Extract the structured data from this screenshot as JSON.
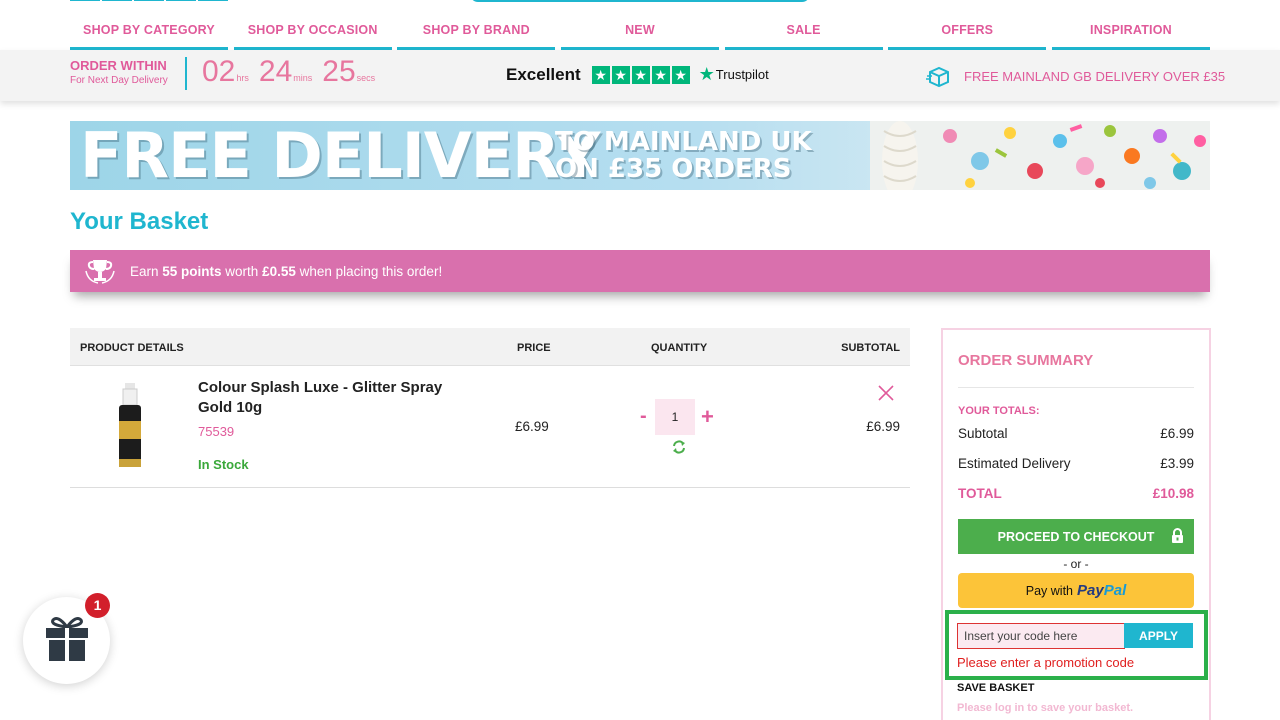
{
  "nav": {
    "items": [
      "SHOP BY CATEGORY",
      "SHOP BY OCCASION",
      "SHOP BY BRAND",
      "NEW",
      "SALE",
      "OFFERS",
      "INSPIRATION"
    ]
  },
  "info_bar": {
    "order_within": "ORDER WITHIN",
    "order_sub": "For Next Day Delivery",
    "hours": "02",
    "hours_unit": "hrs",
    "mins": "24",
    "mins_unit": "mins",
    "secs": "25",
    "secs_unit": "secs",
    "rating_text": "Excellent",
    "trustpilot": "Trustpilot",
    "delivery_text": "FREE MAINLAND GB DELIVERY OVER £35"
  },
  "banner": {
    "headline": "FREE DELIVERY",
    "line1": "TO MAINLAND UK",
    "line2": "ON £35 ORDERS"
  },
  "page": {
    "title": "Your Basket"
  },
  "points": {
    "prefix": "Earn ",
    "points": "55 points",
    "middle": " worth ",
    "value": "£0.55",
    "suffix": " when placing this order!"
  },
  "table": {
    "headers": [
      "PRODUCT DETAILS",
      "PRICE",
      "QUANTITY",
      "SUBTOTAL"
    ],
    "items": [
      {
        "name": "Colour Splash Luxe - Glitter Spray Gold 10g",
        "code": "75539",
        "stock": "In Stock",
        "price": "£6.99",
        "quantity": "1",
        "subtotal": "£6.99"
      }
    ],
    "minus": "-",
    "plus": "+"
  },
  "summary": {
    "title": "ORDER SUMMARY",
    "totals_label": "YOUR TOTALS:",
    "subtotal_label": "Subtotal",
    "subtotal": "£6.99",
    "delivery_label": "Estimated Delivery",
    "delivery": "£3.99",
    "total_label": "TOTAL",
    "total": "£10.98",
    "checkout": "PROCEED TO CHECKOUT",
    "or": "- or -",
    "paypal_prefix": "Pay with",
    "paypal_a": "Pay",
    "paypal_b": "Pal"
  },
  "promo": {
    "placeholder": "Insert your code here",
    "value": "",
    "apply": "APPLY",
    "error": "Please enter a promotion code",
    "save_basket": "SAVE BASKET",
    "save_note": "Please log in to save your basket."
  },
  "gift": {
    "badge": "1"
  },
  "colors": {
    "teal": "#1fb6cf",
    "pink": "#e05a9a",
    "points_bar": "#d970ad",
    "checkout_green": "#4cae4c",
    "paypal_yellow": "#fcc439",
    "trustpilot_green": "#00b67a",
    "error_red": "#e01f1f",
    "highlight_green": "#2bb04a"
  },
  "icons": {
    "delivery": "box-icon",
    "trophy": "trophy-icon",
    "remove": "close-icon",
    "refresh": "refresh-icon",
    "lock": "lock-icon",
    "gift": "gift-icon",
    "star": "star-icon"
  }
}
